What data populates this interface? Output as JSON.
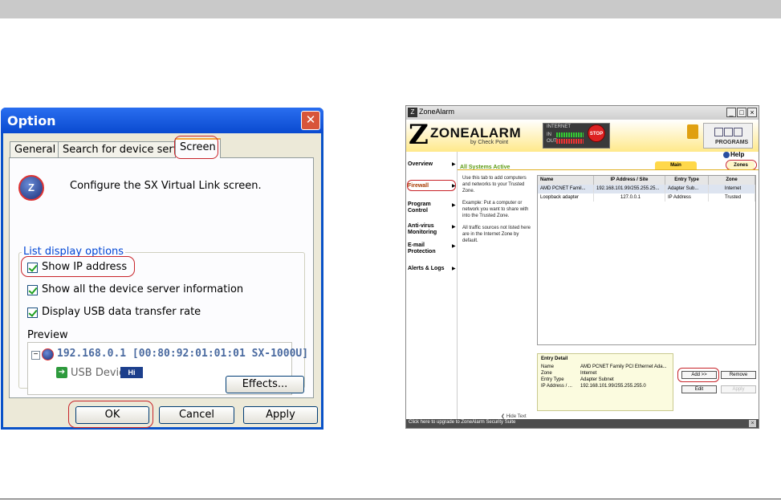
{
  "option_dialog": {
    "title": "Option",
    "close_glyph": "✕",
    "tabs": [
      {
        "label": "General"
      },
      {
        "label": "Search for device servers"
      },
      {
        "label": "Screen"
      }
    ],
    "logo_letter": "Z",
    "description": "Configure the SX Virtual Link screen.",
    "group_title": "List display options",
    "checkboxes": [
      {
        "label": "Show IP address",
        "checked": true
      },
      {
        "label": "Show all the device server information",
        "checked": true
      },
      {
        "label": "Display USB data transfer rate",
        "checked": true
      }
    ],
    "preview_label": "Preview",
    "preview_device": "192.168.0.1 [00:80:92:01:01:01 SX-1000U]",
    "preview_usb": "USB Device",
    "preview_badge": "Hi",
    "effects_button": "Effects...",
    "ok_button": "OK",
    "cancel_button": "Cancel",
    "apply_button": "Apply",
    "colors": {
      "title_bar": "#0a52c8",
      "highlight_ring": "#c8242a",
      "body": "#ece9d8"
    }
  },
  "zonealarm": {
    "title": "ZoneAlarm",
    "brand": "ZONEALARM",
    "brand_sub": "by Check Point",
    "meter_label": "INTERNET",
    "meter_in": "IN",
    "meter_out": "OUT",
    "stop_label": "STOP",
    "programs_label": "PROGRAMS",
    "help_label": "Help",
    "status_text": "All Systems Active",
    "nav": [
      {
        "label": "Overview"
      },
      {
        "label": "Firewall"
      },
      {
        "label": "Program Control"
      },
      {
        "label": "Anti-virus Monitoring"
      },
      {
        "label": "E-mail Protection"
      },
      {
        "label": "Alerts & Logs"
      }
    ],
    "tabs": [
      {
        "label": "Main"
      },
      {
        "label": "Zones"
      }
    ],
    "description": [
      "Use this tab to add computers and networks to your Trusted Zone.",
      "Example: Put a computer or network you want to share with into the Trusted Zone.",
      "All traffic sources not listed here are in the Internet Zone by default."
    ],
    "hide_text": "Hide Text",
    "table": {
      "headers": [
        "Name",
        "IP Address / Site",
        "Entry Type",
        "Zone"
      ],
      "rows": [
        [
          "AMD PCNET Famil...",
          "192.168.101.99/255.255.25...",
          "Adapter Sub...",
          "Internet"
        ],
        [
          "Loopback adapter",
          "127.0.0.1",
          "IP Address",
          "Trusted"
        ]
      ]
    },
    "entry_detail": {
      "title": "Entry Detail",
      "fields": [
        {
          "label": "Name",
          "value": "AMD PCNET Family PCI Ethernet Ada..."
        },
        {
          "label": "Zone",
          "value": "Internet"
        },
        {
          "label": "Entry Type",
          "value": "Adapter Subnet"
        },
        {
          "label": "IP Address / ...",
          "value": "192.168.101.99/255.255.255.0"
        }
      ]
    },
    "buttons": {
      "add": "Add >>",
      "remove": "Remove",
      "edit": "Edit",
      "apply": "Apply"
    },
    "footer": "Click here to upgrade to ZoneAlarm Security Suite",
    "colors": {
      "header_yellow": "#ffe98a",
      "status_green": "#5a9a10",
      "footer": "#4d4d4d"
    }
  }
}
